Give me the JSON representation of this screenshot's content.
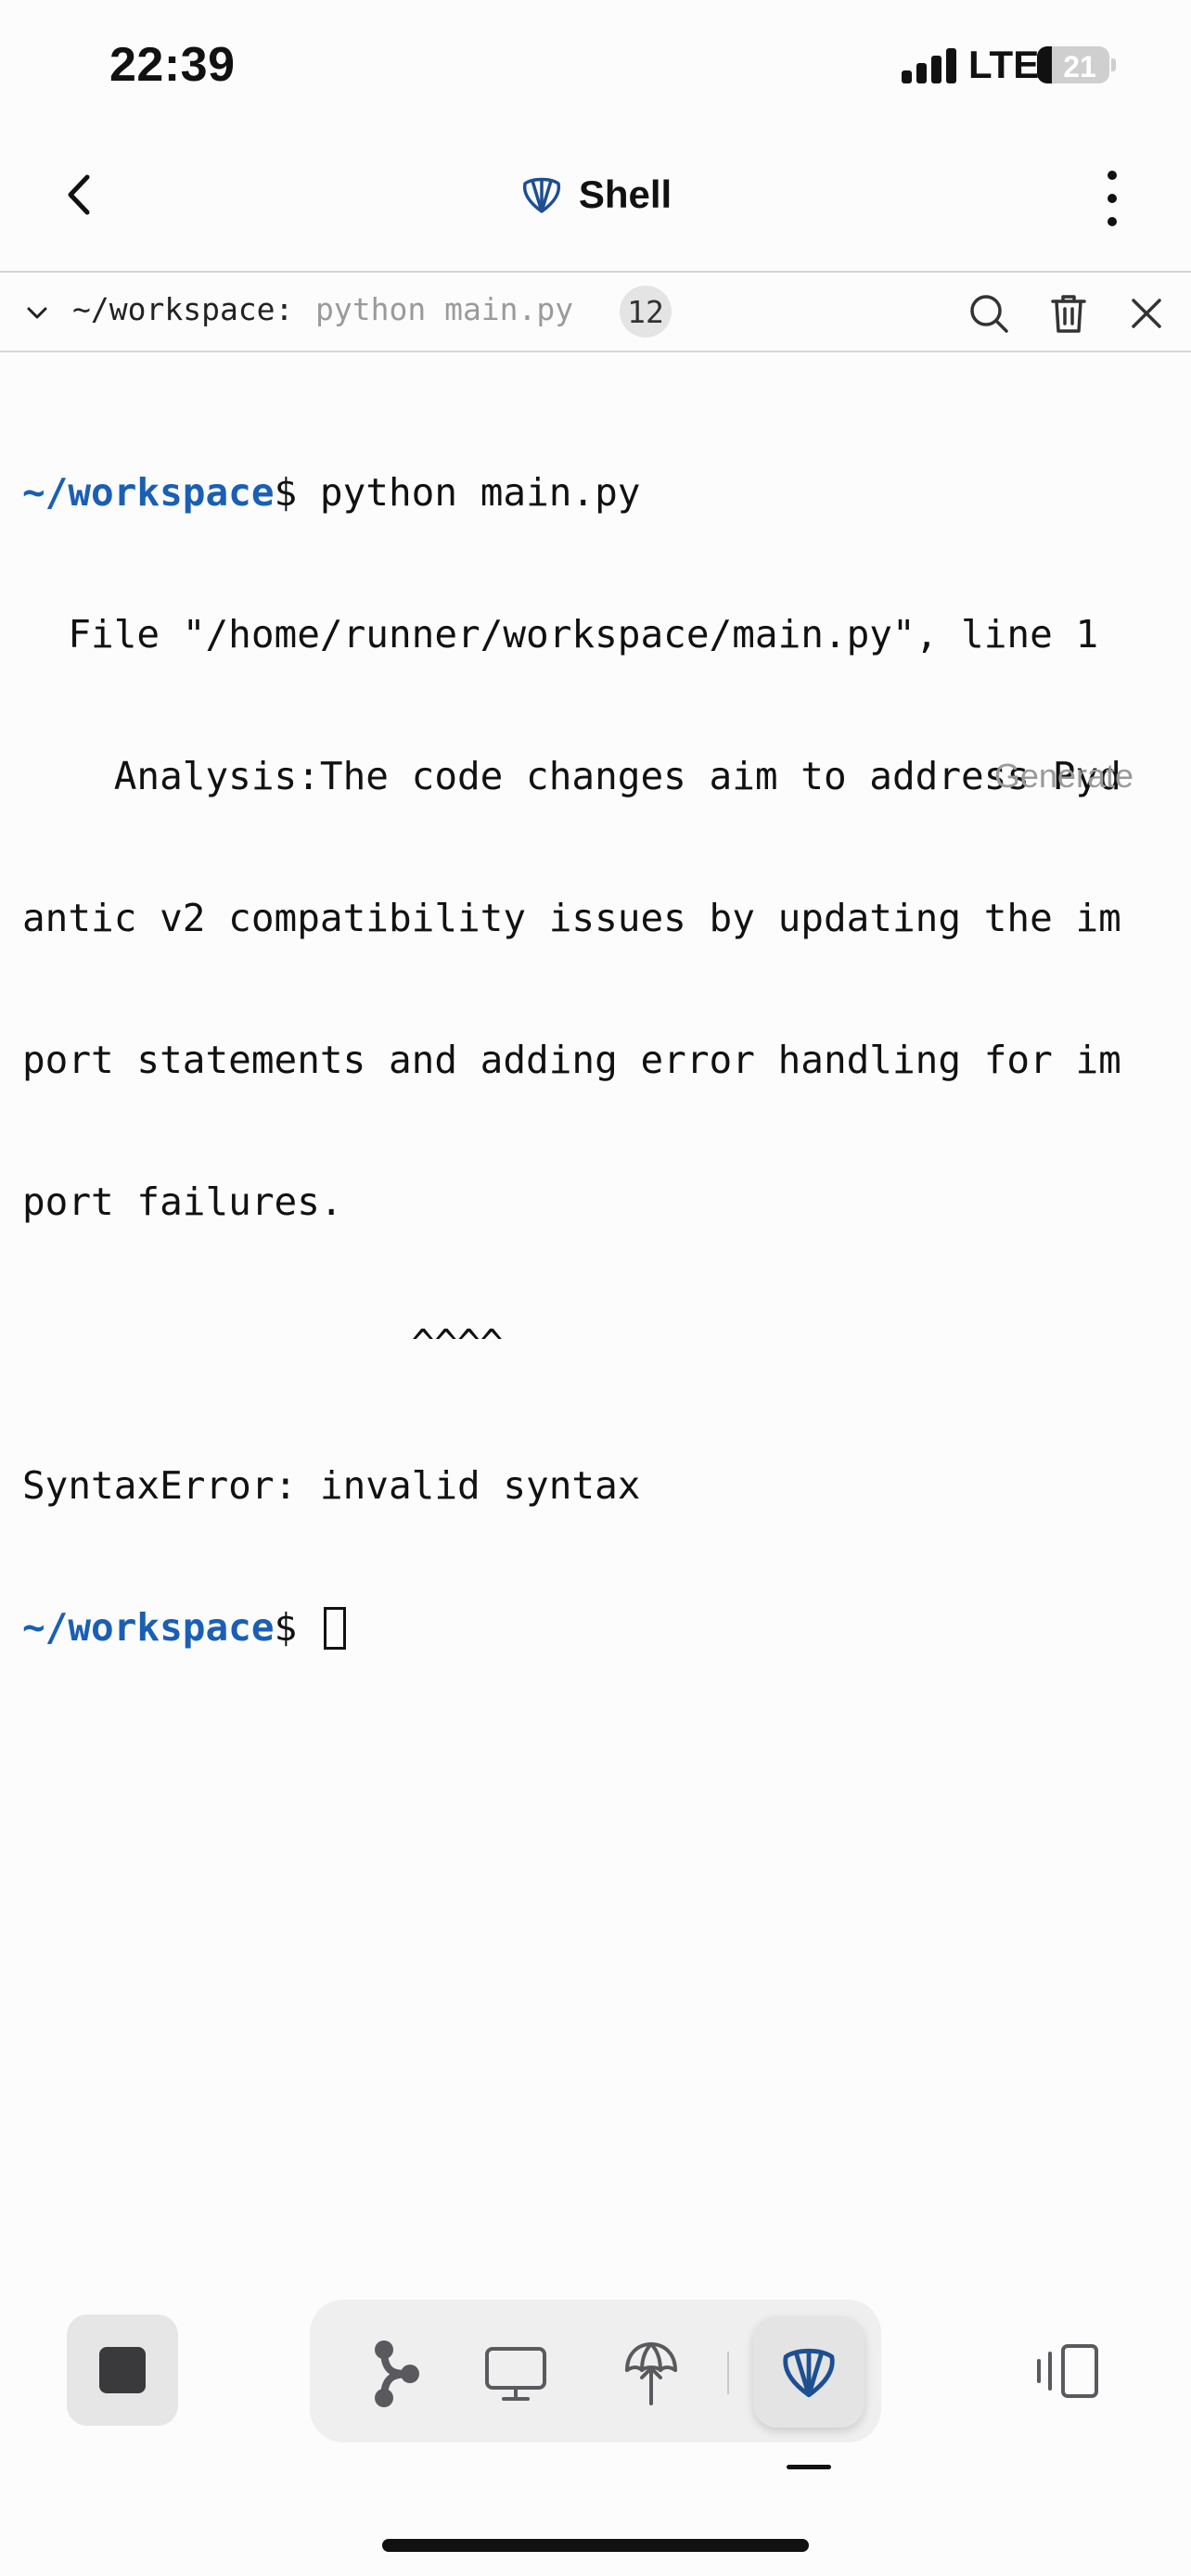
{
  "status_bar": {
    "time": "22:39",
    "network": "LTE",
    "battery_level": "21"
  },
  "header": {
    "title": "Shell",
    "back_icon": "chevron-left-icon",
    "more_icon": "more-vertical-icon",
    "title_icon": "shell-icon"
  },
  "shell_tab": {
    "path": "~/workspace:",
    "command": "python main.py",
    "count": "12",
    "icons": [
      "chevron-down-icon",
      "search-icon",
      "trash-icon",
      "close-icon"
    ]
  },
  "terminal": {
    "prompt": "~/workspace",
    "prompt_suffix": "$ ",
    "first_command": "python main.py",
    "output": [
      "  File \"/home/runner/workspace/main.py\", line 1",
      "    Analysis:The code changes aim to address Pyd",
      "antic v2 compatibility issues by updating the im",
      "port statements and adding error handling for im",
      "port failures.",
      "                 ^^^^",
      "SyntaxError: invalid syntax"
    ],
    "generate_label": "Generate"
  },
  "bottom_bar": {
    "stop_icon": "stop-icon",
    "dock_icons": [
      "git-branch-icon",
      "monitor-icon",
      "deploy-icon",
      "shell-icon"
    ],
    "devices_icon": "devices-icon"
  },
  "colors": {
    "prompt": "#1a5fb4",
    "shell_icon": "#1d4f91",
    "dim_text": "#9a9a9a"
  }
}
